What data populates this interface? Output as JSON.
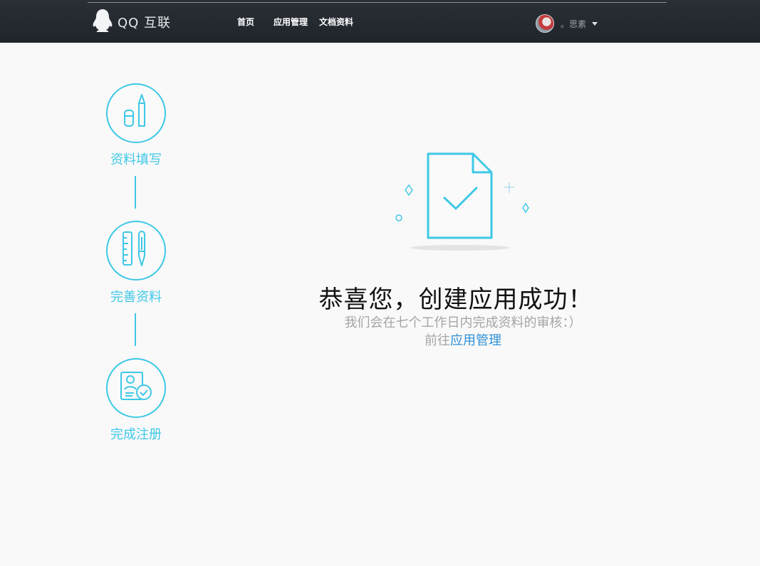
{
  "header": {
    "logo_text": "QQ 互联",
    "nav": [
      {
        "label": "首页"
      },
      {
        "label": "应用管理"
      },
      {
        "label": "文档资料"
      }
    ],
    "user": {
      "name": "。思素"
    }
  },
  "steps": [
    {
      "label": "资料填写",
      "icon": "pencil-eraser-icon"
    },
    {
      "label": "完善资料",
      "icon": "ruler-pen-icon"
    },
    {
      "label": "完成注册",
      "icon": "id-card-check-icon"
    }
  ],
  "main": {
    "title": "恭喜您，创建应用成功！",
    "subtitle": "我们会在七个工作日内完成资料的审核：）",
    "goto_prefix": "前往",
    "goto_link": "应用管理"
  },
  "colors": {
    "accent": "#3ec8e6",
    "link": "#2e8fd6",
    "nav_bg": "#22282e"
  }
}
